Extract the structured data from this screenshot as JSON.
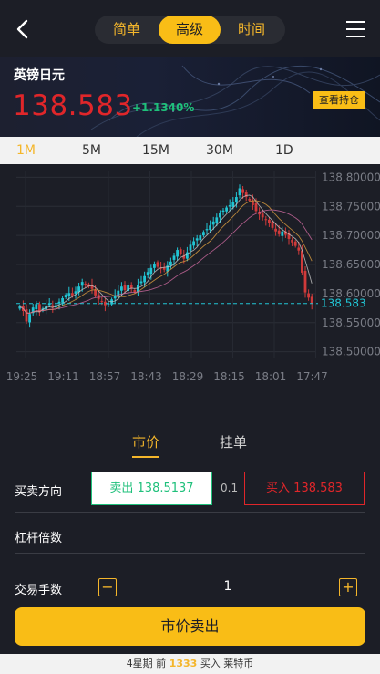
{
  "header": {
    "tabs": [
      "简单",
      "高级",
      "时间"
    ],
    "active_tab": "高级"
  },
  "instrument": {
    "name": "英镑日元",
    "price": "138.583",
    "change": "+1.1340%",
    "hold_button": "查看持仓"
  },
  "periods": {
    "items": [
      "1M",
      "5M",
      "15M",
      "30M",
      "1D"
    ],
    "active": "1M"
  },
  "chart_data": {
    "type": "candlestick",
    "x_labels": [
      "19:25",
      "19:11",
      "18:57",
      "18:43",
      "18:29",
      "18:15",
      "18:01",
      "17:47"
    ],
    "y_ticks": [
      "138.80000",
      "138.75000",
      "138.70000",
      "138.65000",
      "138.60000",
      "138.55000",
      "138.50000"
    ],
    "ylim": [
      138.49,
      138.81
    ],
    "current_price_label": "138.583",
    "current_price": 138.583,
    "closes": [
      138.578,
      138.57,
      138.552,
      138.565,
      138.576,
      138.582,
      138.568,
      138.574,
      138.579,
      138.583,
      138.576,
      138.58,
      138.586,
      138.592,
      138.598,
      138.601,
      138.597,
      138.604,
      138.612,
      138.62,
      138.616,
      138.612,
      138.608,
      138.597,
      138.59,
      138.586,
      138.58,
      138.583,
      138.59,
      138.597,
      138.605,
      138.612,
      138.606,
      138.614,
      138.609,
      138.603,
      138.615,
      138.621,
      138.63,
      138.637,
      138.644,
      138.651,
      138.646,
      138.643,
      138.641,
      138.648,
      138.655,
      138.665,
      138.675,
      138.668,
      138.66,
      138.671,
      138.684,
      138.69,
      138.695,
      138.7,
      138.706,
      138.711,
      138.717,
      138.724,
      138.731,
      138.738,
      138.743,
      138.748,
      138.752,
      138.757,
      138.766,
      138.781,
      138.773,
      138.766,
      138.76,
      138.752,
      138.742,
      138.736,
      138.731,
      138.727,
      138.721,
      138.713,
      138.707,
      138.702,
      138.707,
      138.701,
      138.694,
      138.688,
      138.682,
      138.674,
      138.636,
      138.602,
      138.593,
      138.583
    ]
  },
  "order": {
    "tabs": [
      "市价",
      "挂单"
    ],
    "active_tab": "市价",
    "direction_label": "买卖方向",
    "sell_label": "卖出 138.5137",
    "spread": "0.1",
    "buy_label": "买入 138.583",
    "leverage_label": "杠杆倍数",
    "lots_label": "交易手数",
    "minus": "−",
    "plus": "+",
    "quantity": "1",
    "submit_label": "市价卖出"
  },
  "footer": {
    "prefix": "4星期 前",
    "count": "1333",
    "suffix": "买入 莱特币"
  },
  "colors": {
    "accent": "#f9bd16",
    "up": "#1fc07b",
    "down": "#e0262a",
    "candle_up": "#21c4d3",
    "candle_down": "#d03a3a",
    "background": "#1c1e26"
  }
}
